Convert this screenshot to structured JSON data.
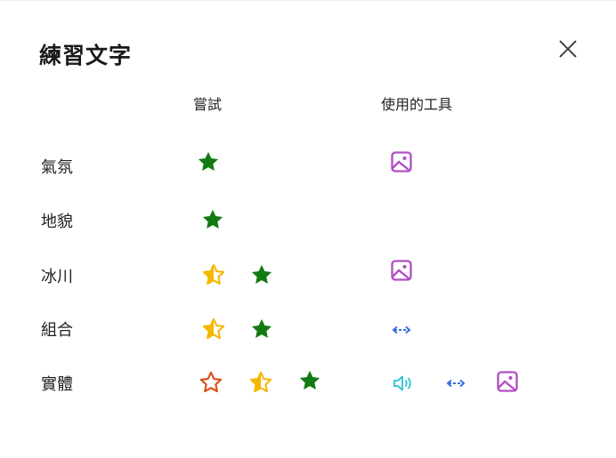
{
  "dialog": {
    "title": "練習文字",
    "close_icon": "close-icon"
  },
  "headers": {
    "attempts": "嘗試",
    "tools_used": "使用的工具"
  },
  "colors": {
    "star_full": "#137a13",
    "star_half": "#f5b800",
    "star_empty": "#e04a12",
    "tool_image": "#b04fc2",
    "tool_arrows": "#3b6fe0",
    "tool_speaker": "#3cc6d6"
  },
  "rows": [
    {
      "label": "氣氛",
      "attempts": [
        "star-full-icon"
      ],
      "tools": [
        "picture-icon"
      ]
    },
    {
      "label": "地貌",
      "attempts": [
        "star-full-icon"
      ],
      "tools": []
    },
    {
      "label": "冰川",
      "attempts": [
        "star-half-icon",
        "star-full-icon"
      ],
      "tools": [
        "picture-icon"
      ]
    },
    {
      "label": "組合",
      "attempts": [
        "star-half-icon",
        "star-full-icon"
      ],
      "tools": [
        "arrows-horizontal-icon"
      ]
    },
    {
      "label": "實體",
      "attempts": [
        "star-empty-icon",
        "star-half-icon",
        "star-full-icon"
      ],
      "tools": [
        "speaker-icon",
        "arrows-horizontal-icon",
        "picture-icon"
      ]
    }
  ]
}
